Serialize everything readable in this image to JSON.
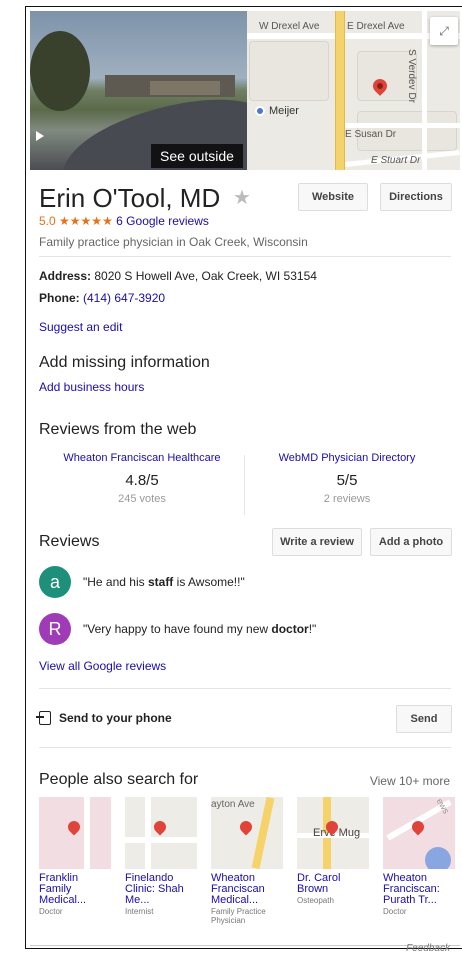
{
  "hero": {
    "photo_button": "See outside",
    "map_labels": {
      "drexel_w": "W Drexel Ave",
      "drexel_e": "E Drexel Ave",
      "verdev": "S Verdev Dr",
      "meijer": "Meijer",
      "susan": "E Susan Dr",
      "stuart": "E Stuart Dr"
    },
    "expand_icon": "expand-icon"
  },
  "business": {
    "name": "Erin O'Tool, MD",
    "rating": "5.0",
    "stars": "★★★★★",
    "reviews_link": "6 Google reviews",
    "category": "Family practice physician in Oak Creek, Wisconsin",
    "website_label": "Website",
    "directions_label": "Directions"
  },
  "info": {
    "address_label": "Address:",
    "address": "8020 S Howell Ave, Oak Creek, WI 53154",
    "phone_label": "Phone:",
    "phone": "(414) 647-3920",
    "suggest_edit": "Suggest an edit",
    "missing_title": "Add missing information",
    "add_hours": "Add business hours"
  },
  "web_reviews": {
    "title": "Reviews from the web",
    "sources": [
      {
        "name": "Wheaton Franciscan Healthcare",
        "score": "4.8/5",
        "count": "245 votes"
      },
      {
        "name": "WebMD Physician Directory",
        "score": "5/5",
        "count": "2 reviews"
      }
    ]
  },
  "reviews": {
    "title": "Reviews",
    "write_label": "Write a review",
    "photo_label": "Add a photo",
    "items": [
      {
        "initial": "a",
        "color": "#1e8f7a",
        "pre": "\"He and his ",
        "bold": "staff",
        "post": " is Awsome!!\""
      },
      {
        "initial": "R",
        "color": "#a03bb7",
        "pre": "\"Very happy to have found my new ",
        "bold": "doctor",
        "post": "!\""
      }
    ],
    "view_all": "View all Google reviews"
  },
  "send": {
    "label": "Send to your phone",
    "button": "Send"
  },
  "people_also": {
    "title": "People also search for",
    "view_more": "View 10+ more",
    "tiles": [
      {
        "line1": "Franklin",
        "line2": "Family",
        "line3": "Medical...",
        "type1": "Doctor",
        "type2": ""
      },
      {
        "line1": "Finelando",
        "line2": "Clinic: Shah",
        "line3": "Me...",
        "type1": "Internist",
        "type2": ""
      },
      {
        "line1": "Wheaton",
        "line2": "Franciscan",
        "line3": "Medical...",
        "type1": "Family Practice",
        "type2": "Physician",
        "map_label": "ayton Ave"
      },
      {
        "line1": "Dr. Carol",
        "line2": "Brown",
        "line3": "",
        "type1": "Osteopath",
        "type2": "",
        "map_label": "Erve Mug"
      },
      {
        "line1": "Wheaton",
        "line2": "Franciscan:",
        "line3": "Purath Tr...",
        "type1": "Doctor",
        "type2": "",
        "map_label": "ews"
      }
    ]
  },
  "feedback": "Feedback"
}
